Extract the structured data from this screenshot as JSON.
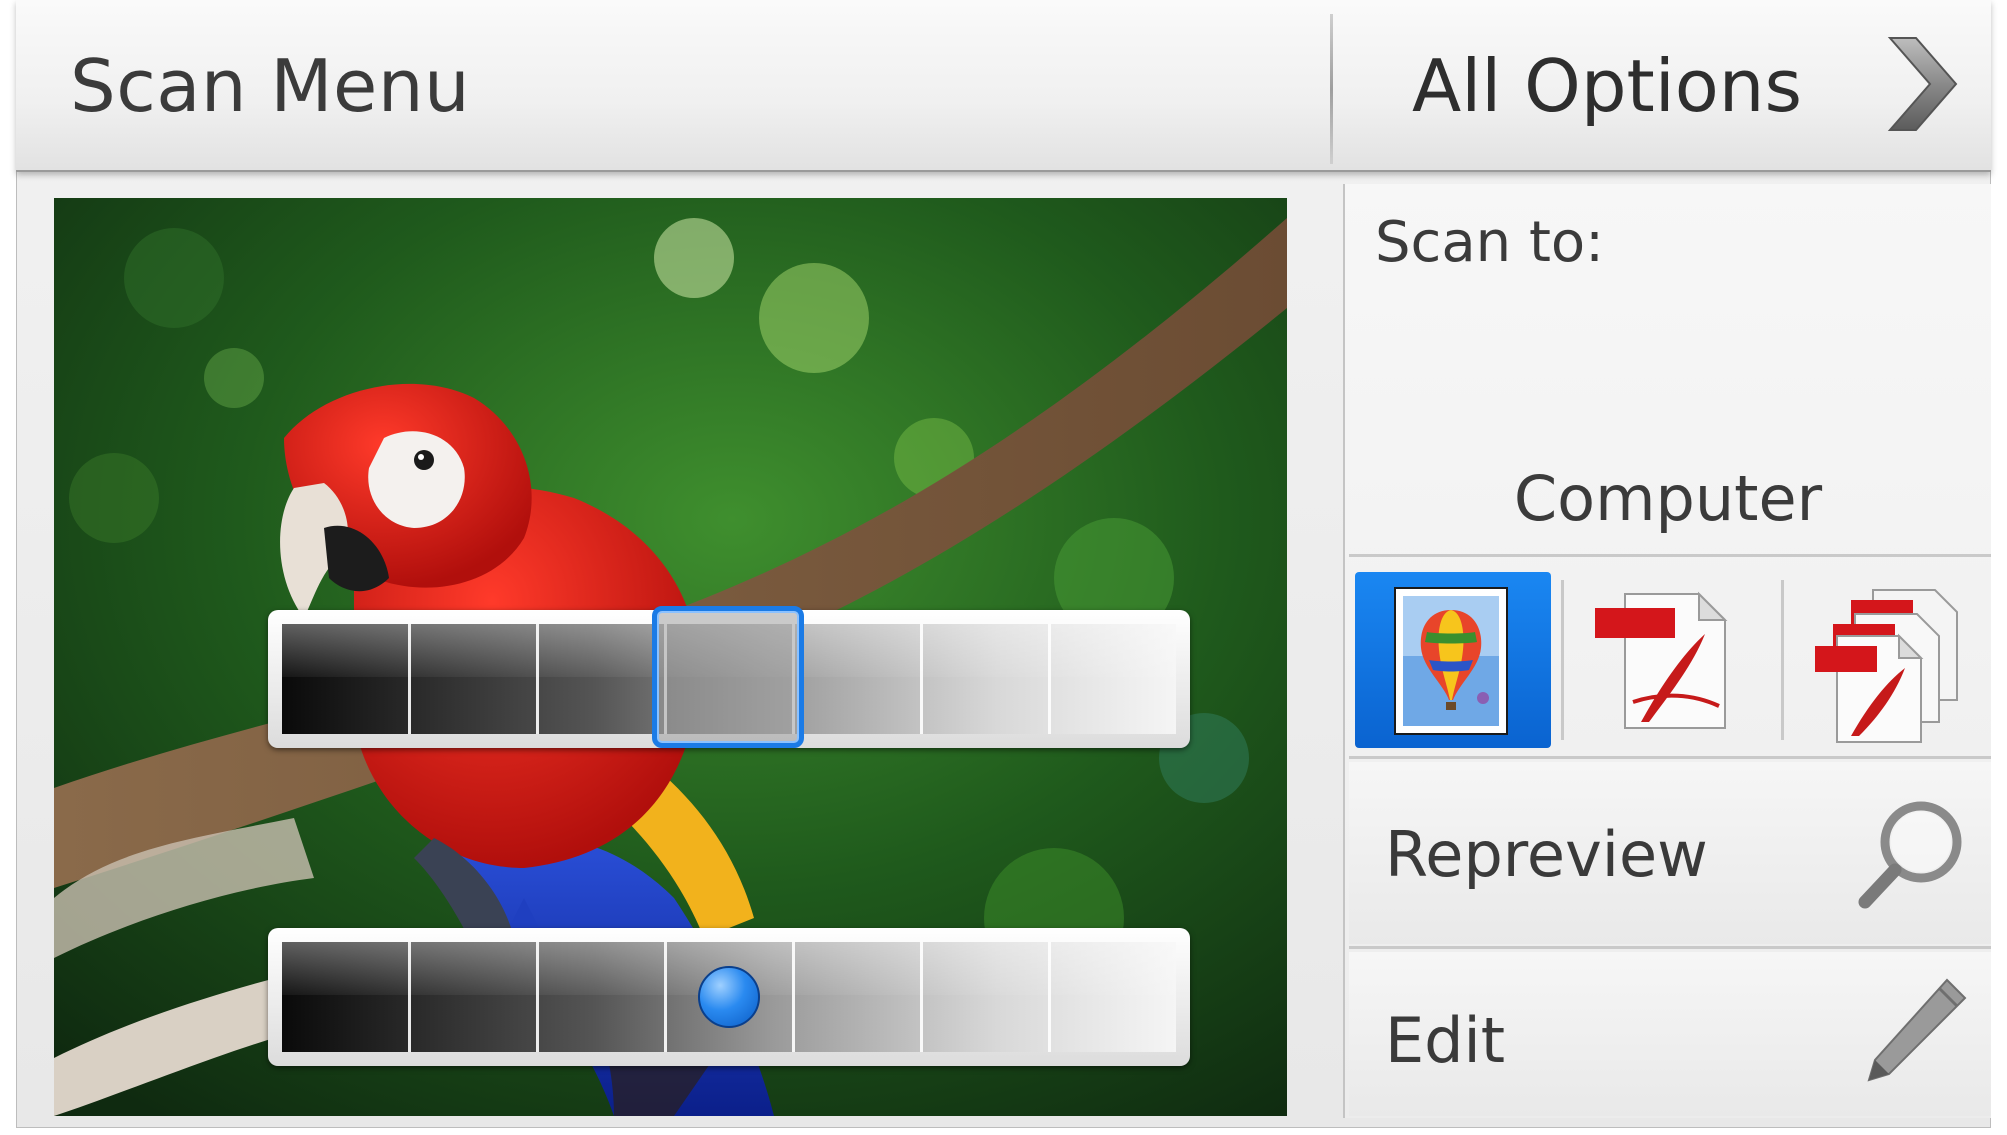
{
  "header": {
    "title": "Scan Menu",
    "all_options_label": "All Options"
  },
  "preview": {
    "image_subject": "red macaw parrot on branch",
    "slider_top": {
      "ticks": 7,
      "selected_position": 0.5
    },
    "slider_bottom": {
      "ticks": 7,
      "knob_position": 0.5
    }
  },
  "side": {
    "scan_to_label": "Scan to:",
    "destination": "Computer",
    "formats": [
      {
        "name": "photo-image",
        "selected": true
      },
      {
        "name": "pdf-single",
        "selected": false
      },
      {
        "name": "pdf-multi",
        "selected": false
      }
    ],
    "repreview_label": "Repreview",
    "edit_label": "Edit"
  },
  "colors": {
    "accent": "#1b7be6",
    "header_bg": "#f2f2f2",
    "text": "#3a3a3a"
  }
}
